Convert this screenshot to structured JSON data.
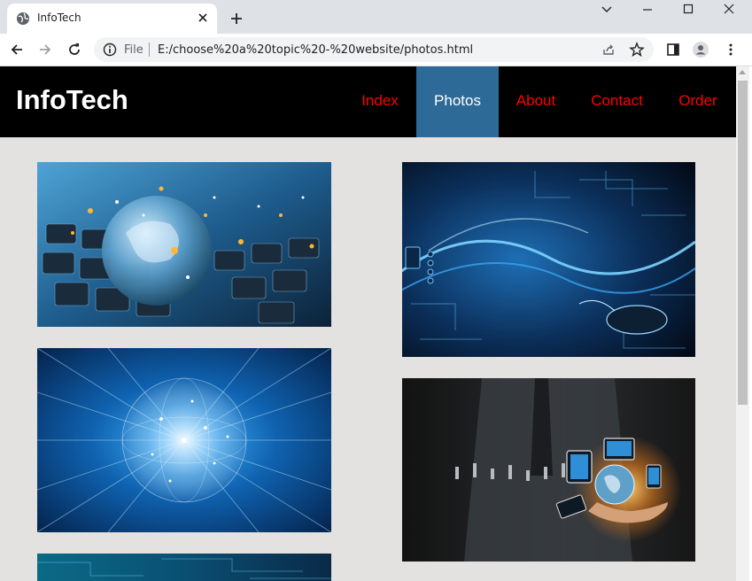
{
  "browser": {
    "tab_title": "InfoTech",
    "omnibox_scheme": "File",
    "url": "E:/choose%20a%20topic%20-%20website/photos.html"
  },
  "site": {
    "logo": "InfoTech",
    "nav": [
      "Index",
      "Photos",
      "About",
      "Contact",
      "Order"
    ],
    "active_nav": "Photos"
  },
  "colors": {
    "header_bg": "#000000",
    "nav_link": "#ff0000",
    "nav_active_bg": "#2d6a97",
    "page_bg": "#e4e2e0"
  },
  "gallery": [
    {
      "name": "laptop-globe-photo"
    },
    {
      "name": "digital-technology-photo"
    },
    {
      "name": "network-sphere-photo"
    },
    {
      "name": "hand-globe-devices-photo"
    },
    {
      "name": "circuit-partial-photo"
    }
  ]
}
